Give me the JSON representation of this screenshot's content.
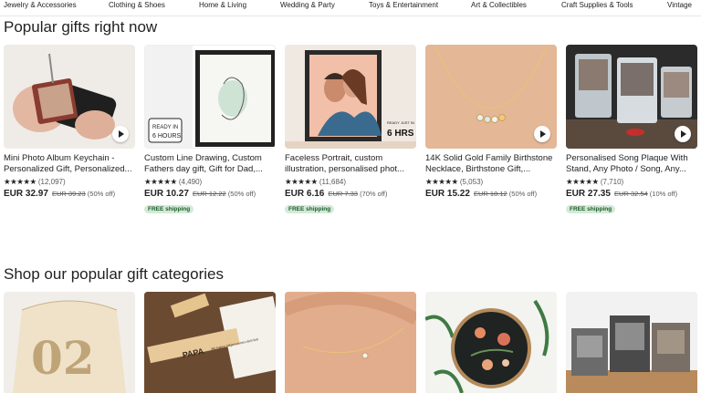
{
  "nav": [
    "Jewelry & Accessories",
    "Clothing & Shoes",
    "Home & Living",
    "Wedding & Party",
    "Toys & Entertainment",
    "Art & Collectibles",
    "Craft Supplies & Tools",
    "Vintage"
  ],
  "sections": {
    "popular_gifts_title": "Popular gifts right now",
    "categories_title": "Shop our popular gift categories"
  },
  "products": [
    {
      "title": "Mini Photo Album Keychain - Personalized Gift, Personalized...",
      "stars": "★★★★★",
      "reviews": "(12,097)",
      "price": "EUR 32.97",
      "original": "EUR 39.23",
      "discount": "(50% off)",
      "free_shipping": ""
    },
    {
      "title": "Custom Line Drawing, Custom Fathers day gift, Gift for Dad,...",
      "stars": "★★★★★",
      "reviews": "(4,490)",
      "price": "EUR 10.27",
      "original": "EUR 12.22",
      "discount": "(50% off)",
      "free_shipping": "FREE shipping"
    },
    {
      "title": "Faceless Portrait, custom illustration, personalised phot...",
      "stars": "★★★★★",
      "reviews": "(11,684)",
      "price": "EUR 6.16",
      "original": "EUR 7.33",
      "discount": "(70% off)",
      "free_shipping": "FREE shipping"
    },
    {
      "title": "14K Solid Gold Family Birthstone Necklace, Birthstone Gift,...",
      "stars": "★★★★★",
      "reviews": "(5,053)",
      "price": "EUR 15.22",
      "original": "EUR 18.12",
      "discount": "(50% off)",
      "free_shipping": ""
    },
    {
      "title": "Personalised Song Plaque With Stand, Any Photo / Song, Any...",
      "stars": "★★★★★",
      "reviews": "(7,710)",
      "price": "EUR 27.35",
      "original": "EUR 32.54",
      "discount": "(10% off)",
      "free_shipping": "FREE shipping"
    }
  ],
  "image_text": {
    "ready_badge_1": "READY IN",
    "ready_badge_2": "6 HOURS",
    "ready_badge_3": "READY JUST IN",
    "ready_badge_4": "6 HRS",
    "papa_tag": "PAPA",
    "papa_note": "Wir haben mitgenommen dich lieb",
    "album_digits": "02"
  },
  "colors": {
    "free_shipping_bg": "#d4e9d7",
    "free_shipping_text": "#1d5e2c"
  }
}
